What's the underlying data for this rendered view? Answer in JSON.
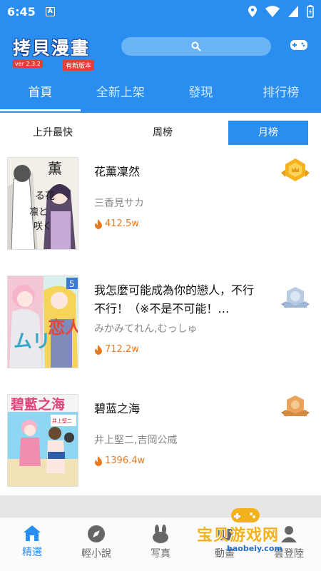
{
  "status_bar": {
    "time": "6:45",
    "a_icon": "A"
  },
  "header": {
    "logo_title": "拷貝漫畫",
    "logo_version": "ver 2.3.2",
    "logo_badge": "有新版本",
    "tabs": [
      {
        "label": "首頁",
        "active": true
      },
      {
        "label": "全新上架",
        "active": false
      },
      {
        "label": "發現",
        "active": false
      },
      {
        "label": "排行榜",
        "active": false
      }
    ]
  },
  "subtabs": [
    {
      "label": "上升最快",
      "active": false
    },
    {
      "label": "周榜",
      "active": false
    },
    {
      "label": "月榜",
      "active": true
    }
  ],
  "items": [
    {
      "title": "花薰凜然",
      "author": "三香見サカ",
      "views": "412.5w",
      "medal": "gold"
    },
    {
      "title": "我怎麼可能成為你的戀人，不行不行！（※不是不可能！…",
      "author": "みかみてれん,むっしゅ",
      "views": "712.2w",
      "medal": "silver"
    },
    {
      "title": "碧蓝之海",
      "author": "井上堅二,吉岡公威",
      "views": "1396.4w",
      "medal": "bronze"
    }
  ],
  "bottom_nav": [
    {
      "label": "精選",
      "active": true,
      "icon": "home-icon"
    },
    {
      "label": "輕小說",
      "active": false,
      "icon": "compass-icon"
    },
    {
      "label": "写真",
      "active": false,
      "icon": "bunny-icon"
    },
    {
      "label": "動畫",
      "active": false,
      "icon": "tv-icon"
    },
    {
      "label": "雲登陸",
      "active": false,
      "icon": "user-icon"
    }
  ],
  "watermark": {
    "text": "宝贝游戏网",
    "url": "baobeiy.com"
  },
  "colors": {
    "accent": "#2a8ef0",
    "views": "#e8791e"
  }
}
